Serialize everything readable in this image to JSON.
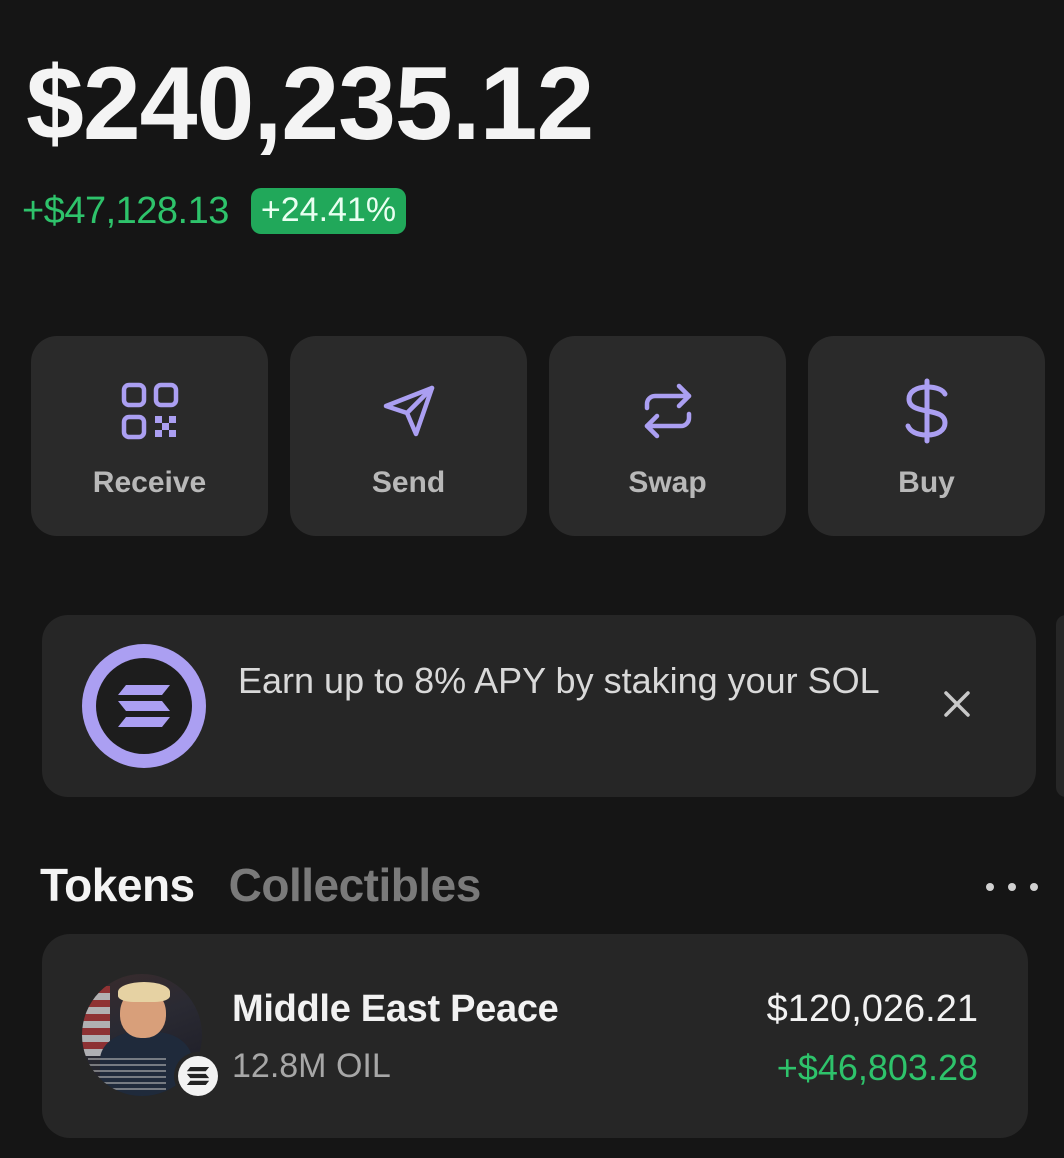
{
  "balance": {
    "total": "$240,235.12",
    "change_amount": "+$47,128.13",
    "change_percent": "+24.41%"
  },
  "actions": [
    {
      "label": "Receive",
      "icon": "qr-code-icon"
    },
    {
      "label": "Send",
      "icon": "send-icon"
    },
    {
      "label": "Swap",
      "icon": "swap-icon"
    },
    {
      "label": "Buy",
      "icon": "dollar-icon"
    }
  ],
  "promo": {
    "text": "Earn up to 8% APY by staking your SOL",
    "logo": "solana-logo",
    "close_icon": "close-icon"
  },
  "tabs": {
    "tokens": "Tokens",
    "collectibles": "Collectibles",
    "more_icon": "more-icon"
  },
  "tokens": [
    {
      "name": "Middle East Peace",
      "amount": "12.8M OIL",
      "value": "$120,026.21",
      "change": "+$46,803.28"
    }
  ],
  "colors": {
    "background": "#151515",
    "card": "#2a2a2a",
    "accent_purple": "#ab9ff2",
    "positive_green": "#2ec36b",
    "badge_green": "#21a85a"
  }
}
